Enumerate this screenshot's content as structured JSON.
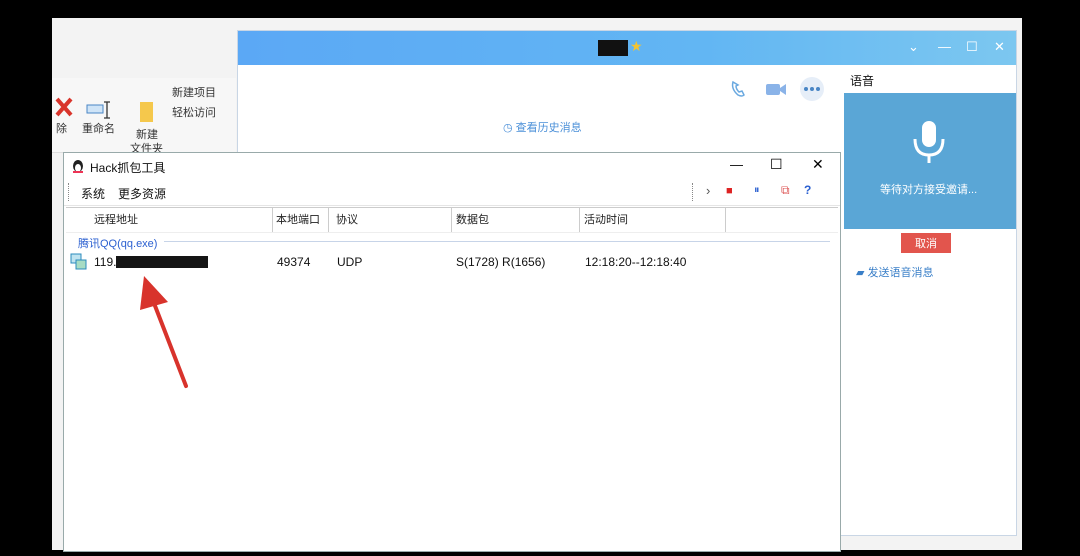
{
  "explorer": {
    "rename_label": "重命名",
    "new_folder_label_1": "新建",
    "new_folder_label_2": "文件夹",
    "new_item_label": "新建项目",
    "easy_access_label": "轻松访问",
    "delete_partial_label": "除"
  },
  "qq": {
    "history_link": "查看历史消息",
    "voice_tab": "语音",
    "waiting_text": "等待对方接受邀请...",
    "cancel_label": "取消",
    "send_voice_message": "发送语音消息",
    "window_controls": [
      "⌄",
      "—",
      "☐",
      "✕"
    ]
  },
  "hack": {
    "title": "Hack抓包工具",
    "menu": [
      "系统",
      "更多资源"
    ],
    "window_controls": [
      "—",
      "☐",
      "✕"
    ],
    "toolbar": [
      "›",
      "■",
      "⏸",
      "⧉",
      "?"
    ],
    "columns": [
      "远程地址",
      "本地端口",
      "协议",
      "数据包",
      "活动时间"
    ],
    "group": "腾讯QQ(qq.exe)",
    "rows": [
      {
        "remote": "119.",
        "port": "49374",
        "protocol": "UDP",
        "packets": "S(1728) R(1656)",
        "time": "12:18:20--12:18:40"
      }
    ]
  },
  "colors": {
    "arrow": "#d8332c",
    "qq_title": "#5ba8f5",
    "voice_panel": "#5aa6d6",
    "cancel": "#e2554d"
  }
}
